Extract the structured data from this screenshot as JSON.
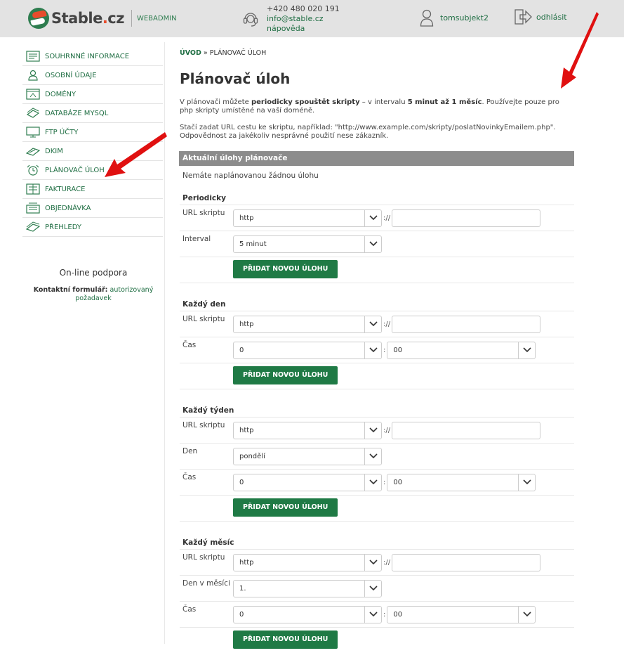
{
  "header": {
    "logo_text": "Stable",
    "logo_dot": ".",
    "logo_tld": "cz",
    "logo_sub": "WEBADMIN",
    "phone": "+420 480 020 191",
    "email": "info@stable.cz",
    "help": "nápověda",
    "username": "tomsubjekt2",
    "logout": "odhlásit"
  },
  "sidebar": {
    "items": [
      {
        "label": "SOUHRNNÉ INFORMACE",
        "icon": "summary-icon"
      },
      {
        "label": "OSOBNÍ ÚDAJE",
        "icon": "person-icon"
      },
      {
        "label": "DOMÉNY",
        "icon": "domain-icon"
      },
      {
        "label": "DATABÁZE MYSQL",
        "icon": "database-icon"
      },
      {
        "label": "FTP ÚČTY",
        "icon": "ftp-icon"
      },
      {
        "label": "DKIM",
        "icon": "dkim-icon"
      },
      {
        "label": "PLÁNOVAČ ÚLOH",
        "icon": "alarm-clock-icon"
      },
      {
        "label": "FAKTURACE",
        "icon": "invoice-icon"
      },
      {
        "label": "OBJEDNÁVKA",
        "icon": "order-icon"
      },
      {
        "label": "PŘEHLEDY",
        "icon": "reports-icon"
      }
    ],
    "support_title": "On-line podpora",
    "support_label": "Kontaktní formulář:",
    "support_link_1": "autorizovaný",
    "support_link_2": "požadavek"
  },
  "main": {
    "breadcrumb_home": "ÚVOD",
    "breadcrumb_sep": " » ",
    "breadcrumb_current": "PLÁNOVAČ ÚLOH",
    "title": "Plánovač úloh",
    "intro1_a": "V plánovači můžete ",
    "intro1_b": "periodicky spouštět skripty",
    "intro1_c": " – v intervalu ",
    "intro1_d": "5 minut až 1 měsíc",
    "intro1_e": ". Používejte pouze pro php skripty umístěné na vaší doméně.",
    "intro2_a": "Stačí zadat URL cestu ke skriptu, například: \"http://www.example.com/skripty/poslatNovinkyEmailem.php\".",
    "intro2_b": "Odpovědnost za jakékoliv nesprávné použití nese zákazník.",
    "current_header": "Aktuální úlohy plánovače",
    "no_tasks": "Nemáte naplánovanou žádnou úlohu",
    "url_sep": "://",
    "time_sep": ":",
    "add_button": "PŘIDAT NOVOU ÚLOHU",
    "periodic": {
      "title": "Periodicky",
      "url_label": "URL skriptu",
      "protocol": "http",
      "interval_label": "Interval",
      "interval": "5 minut"
    },
    "daily": {
      "title": "Každý den",
      "url_label": "URL skriptu",
      "protocol": "http",
      "time_label": "Čas",
      "hour": "0",
      "minute": "00"
    },
    "weekly": {
      "title": "Každý týden",
      "url_label": "URL skriptu",
      "protocol": "http",
      "day_label": "Den",
      "day": "pondělí",
      "time_label": "Čas",
      "hour": "0",
      "minute": "00"
    },
    "monthly": {
      "title": "Každý měsíc",
      "url_label": "URL skriptu",
      "protocol": "http",
      "day_label": "Den v měsíci",
      "day": "1.",
      "time_label": "Čas",
      "hour": "0",
      "minute": "00"
    }
  },
  "colors": {
    "accent": "#1f7a45",
    "annotation": "#e01010",
    "header_bg": "#e3e3e3"
  }
}
